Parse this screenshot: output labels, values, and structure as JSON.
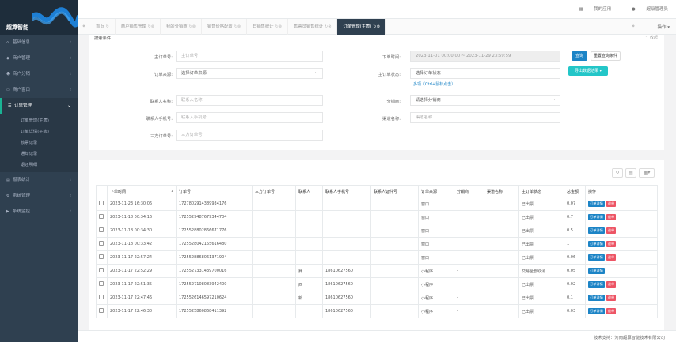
{
  "brand": {
    "name": "超算智能"
  },
  "sidebar": {
    "items": [
      {
        "label": "基础信息",
        "icon": "home-icon"
      },
      {
        "label": "商户管理",
        "icon": "diamond-icon"
      },
      {
        "label": "商户分销",
        "icon": "users-icon"
      },
      {
        "label": "商户窗口",
        "icon": "monitor-icon"
      },
      {
        "label": "订单管理",
        "icon": "list-icon"
      },
      {
        "label": "报表统计",
        "icon": "chart-icon"
      },
      {
        "label": "系统管理",
        "icon": "gear-icon"
      },
      {
        "label": "系统监控",
        "icon": "video-icon"
      }
    ],
    "sub_items": [
      "订单管理(主表)",
      "订单详情(子表)",
      "核票记录",
      "通知记录",
      "退还明细"
    ]
  },
  "topbar": {
    "my_apps": "我的应用",
    "user": "超级管理员"
  },
  "tabs": {
    "items": [
      {
        "label": "首页"
      },
      {
        "label": "商户销售管理"
      },
      {
        "label": "我的分销商"
      },
      {
        "label": "销售价格配置"
      },
      {
        "label": "日销售统计"
      },
      {
        "label": "售票员销售统计"
      },
      {
        "label": "订单管理(主表)"
      }
    ],
    "operations": "操作"
  },
  "search": {
    "section_title": "搜索条件",
    "collapse": "^ 收起",
    "main_order_label": "主订单号:",
    "main_order_placeholder": "主订单号",
    "order_time_label": "下单时间:",
    "order_time_value": "2023-11-01 00:00:00 ~ 2023-11-29 23:59:59",
    "source_label": "订单来源:",
    "source_value": "选择订单来源",
    "status_label": "主订单状态:",
    "status_value": "选择订单状态",
    "multi_hint": "多项（Ctrl+鼠标点击）",
    "contact_name_label": "联系人名称:",
    "contact_name_placeholder": "联系人名称",
    "distributor_label": "分销商:",
    "distributor_value": "请选择分销商",
    "contact_phone_label": "联系人手机号:",
    "contact_phone_placeholder": "联系人手机号",
    "channel_label": "渠道名称:",
    "channel_placeholder": "渠道名称",
    "third_party_label": "三方订单号:",
    "third_party_placeholder": "三方订单号",
    "query_button": "查询",
    "reset_button": "重置查询条件",
    "export_button": "导出数据结果 ▾"
  },
  "table": {
    "columns": [
      "下单时间",
      "订单号",
      "三方订单号",
      "联系人",
      "联系人手机号",
      "联系人证件号",
      "订单来源",
      "分销商",
      "渠道名称",
      "主订单状态",
      "总金额",
      "操作"
    ],
    "rows": [
      {
        "time": "2023-11-23 16:30:06",
        "order": "1727802914389934176",
        "third": "",
        "contact": "",
        "phone": "",
        "id": "",
        "source": "窗口",
        "dist": "",
        "channel": "",
        "status": "已出票",
        "amount": "0.07",
        "ops": [
          "订单详情",
          "退单"
        ]
      },
      {
        "time": "2023-11-18 00:34:16",
        "order": "1725529487679344704",
        "third": "",
        "contact": "",
        "phone": "",
        "id": "",
        "source": "窗口",
        "dist": "",
        "channel": "",
        "status": "已出票",
        "amount": "0.7",
        "ops": [
          "订单详情",
          "退单"
        ]
      },
      {
        "time": "2023-11-18 00:34:30",
        "order": "1725528802866671776",
        "third": "",
        "contact": "",
        "phone": "",
        "id": "",
        "source": "窗口",
        "dist": "",
        "channel": "",
        "status": "已出票",
        "amount": "0.5",
        "ops": [
          "订单详情",
          "退单"
        ]
      },
      {
        "time": "2023-11-18 00:33:42",
        "order": "1725528042155616480",
        "third": "",
        "contact": "",
        "phone": "",
        "id": "",
        "source": "窗口",
        "dist": "",
        "channel": "",
        "status": "已出票",
        "amount": "1",
        "ops": [
          "订单详情",
          "退单"
        ]
      },
      {
        "time": "2023-11-17 22:57:24",
        "order": "1725528868061371904",
        "third": "",
        "contact": "",
        "phone": "",
        "id": "",
        "source": "窗口",
        "dist": "",
        "channel": "",
        "status": "已出票",
        "amount": "0.06",
        "ops": [
          "订单详情",
          "退单"
        ]
      },
      {
        "time": "2023-11-17 22:52:29",
        "order": "1725527331439700016",
        "third": "",
        "contact": "赛",
        "phone": "18610627560",
        "id": "",
        "source": "小程序",
        "dist": "-",
        "channel": "",
        "status": "交易全部取消",
        "amount": "0.05",
        "ops": [
          "订单详情"
        ]
      },
      {
        "time": "2023-11-17 22:51:35",
        "order": "1725527108083942400",
        "third": "",
        "contact": "西",
        "phone": "18610627560",
        "id": "",
        "source": "小程序",
        "dist": "-",
        "channel": "",
        "status": "已出票",
        "amount": "0.02",
        "ops": [
          "订单详情",
          "退单"
        ]
      },
      {
        "time": "2023-11-17 22:47:46",
        "order": "1725526146597210624",
        "third": "",
        "contact": "新",
        "phone": "18610627560",
        "id": "",
        "source": "小程序",
        "dist": "-",
        "channel": "",
        "status": "已出票",
        "amount": "0.1",
        "ops": [
          "订单详情",
          "退单"
        ]
      },
      {
        "time": "2023-11-17 22:46:30",
        "order": "1725525860868411392",
        "third": "",
        "contact": "",
        "phone": "18610627560",
        "id": "",
        "source": "小程序",
        "dist": "-",
        "channel": "",
        "status": "已出票",
        "amount": "0.03",
        "ops": [
          "订单详情",
          "退单"
        ]
      }
    ]
  },
  "footer": {
    "text": "技术支持：河南超算智能技术有限公司"
  }
}
